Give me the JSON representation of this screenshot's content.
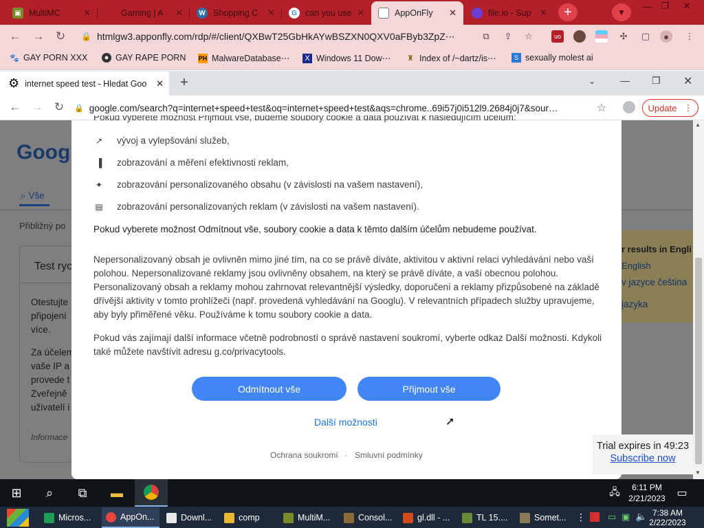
{
  "outer_tabs": [
    {
      "title": "MultiMC",
      "icon": "multimc-icon",
      "color": "#7a8a2a"
    },
    {
      "title": "Gaming | A",
      "icon": "gaming-icon",
      "color": "#b3202a"
    },
    {
      "title": "Shopping C",
      "icon": "wordpress-icon",
      "color": "#2f6fa8"
    },
    {
      "title": "can you use",
      "icon": "google-icon",
      "color": "#ffffff"
    },
    {
      "title": "AppOnFly",
      "icon": "apponfly-icon",
      "color": "#ffffff",
      "active": true
    },
    {
      "title": "file.io - Sup",
      "icon": "fileio-icon",
      "color": "#6a3fd6"
    }
  ],
  "outer_url": "htmlgw3.apponfly.com/rdp/#/client/QXBwT25GbHkAYwBSZXN0QXV0aFByb3ZpZ⋯",
  "bookmarks": [
    {
      "label": "GAY PORN XXX",
      "icon": "paw-icon"
    },
    {
      "label": "GAY RAPE PORN",
      "icon": "bookmark-icon"
    },
    {
      "label": "MalwareDatabase⋯",
      "icon": "ph-icon"
    },
    {
      "label": "Windows 11 Dow⋯",
      "icon": "x-icon"
    },
    {
      "label": "Index of /~dartz/is⋯",
      "icon": "folder-icon"
    },
    {
      "label": "sexually molest ai",
      "icon": "site-icon"
    }
  ],
  "inner_tab": {
    "title": "internet speed test - Hledat Goo"
  },
  "inner_url": "google.com/search?q=internet+speed+test&oq=internet+speed+test&aqs=chrome..69i57j0i512l9.2684j0j7&sour…",
  "update_label": "Update",
  "background_page": {
    "logo": "Google",
    "tab_all": "Vše",
    "results_count": "Přibližný po",
    "card_title": "Test ryc",
    "card_text": [
      "Otestujte",
      "připojení",
      "více."
    ],
    "card_text2": [
      "Za účelem",
      "vaše IP a",
      "provede t",
      "Zveřejně",
      "uživatelí i"
    ],
    "card_info": "Informace",
    "lang_title": "r results in Engli",
    "lang_1": "English",
    "lang_2": "v jazyce čeština",
    "lang_3": "jazyka"
  },
  "dialog": {
    "top_cut": "Pokud vyberete možnost Přijmout vše, budeme soubory cookie a data používat k následujícím účelům:",
    "items": [
      "vývoj a vylepšování služeb,",
      "zobrazování a měření efektivnosti reklam,",
      "zobrazování personalizovaného obsahu (v závislosti na vašem nastavení),",
      "zobrazování personalizovaných reklam (v závislosti na vašem nastavení)."
    ],
    "reject_note": "Pokud vyberete možnost Odmítnout vše, soubory cookie a data k těmto dalším účelům nebudeme používat.",
    "para1": "Nepersonalizovaný obsah je ovlivněn mimo jiné tím, na co se právě díváte, aktivitou v aktivní relaci vyhledávání nebo vaší polohou. Nepersonalizované reklamy jsou ovlivněny obsahem, na který se právě díváte, a vaší obecnou polohou. Personalizovaný obsah a reklamy mohou zahrnovat relevantnější výsledky, doporučení a reklamy přizpůsobené na základě dřívější aktivity v tomto prohlížeči (např. provedená vyhledávání na Googlu). V relevantních případech služby upravujeme, aby byly přiměřené věku. Používáme k tomu soubory cookie a data.",
    "para2": "Pokud vás zajímají další informace včetně podrobností o správě nastavení soukromí, vyberte odkaz Další možnosti. Kdykoli také můžete navštívit adresu g.co/privacytools.",
    "reject_button": "Odmítnout vše",
    "accept_button": "Přijmout vše",
    "more_options": "Další možnosti",
    "footer_privacy": "Ochrana soukromí",
    "footer_sep": "·",
    "footer_terms": "Smluvní podmínky"
  },
  "trial": {
    "text": "Trial expires in 49:23",
    "link": "Subscribe now"
  },
  "inner_clock": {
    "time": "6:11 PM",
    "date": "2/21/2023"
  },
  "outer_taskbar": [
    {
      "label": "Micros...",
      "color": "#1f9d55"
    },
    {
      "label": "AppOn...",
      "color": "#e8453c"
    },
    {
      "label": "Downl...",
      "color": "#e9e9e9"
    },
    {
      "label": "comp",
      "color": "#e8b830"
    },
    {
      "label": "MultiM...",
      "color": "#7a8a2a"
    },
    {
      "label": "Consol...",
      "color": "#8a6a3a"
    },
    {
      "label": "gl.dll - ...",
      "color": "#d44a1a"
    },
    {
      "label": "TL 15....",
      "color": "#6a8a3a"
    },
    {
      "label": "Somet...",
      "color": "#8a7a5a"
    }
  ],
  "outer_clock": {
    "time": "7:38 AM",
    "date": "2/22/2023"
  }
}
